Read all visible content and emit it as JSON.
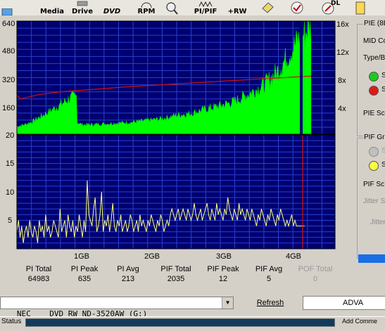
{
  "toolbar": {
    "buttons": [
      {
        "label": "Media",
        "icon": "cd-media-icon"
      },
      {
        "label": "Drive",
        "icon": "drive-icon"
      },
      {
        "label": "DVD",
        "icon": "dvd-logo-icon"
      },
      {
        "label": "RPM",
        "icon": "rpm-gauge-icon"
      },
      {
        "label": "",
        "icon": "magnifier-disc-icon"
      },
      {
        "label": "PI/PIF",
        "icon": "pi-pif-wave-icon"
      },
      {
        "label": "+RW",
        "icon": "plus-rw-icon"
      },
      {
        "label": "",
        "icon": "eraser-icon"
      },
      {
        "label": "",
        "icon": "disc-check-icon"
      },
      {
        "label": "DL",
        "icon": "dual-layer-disc-icon"
      },
      {
        "label": "",
        "icon": "document-icon"
      }
    ]
  },
  "chart_data": [
    {
      "type": "area",
      "subtype": "PI errors (bars) with read speed line",
      "y_left_ticks": [
        "640",
        "480",
        "320",
        "160",
        "20"
      ],
      "y_right_ticks": [
        "16x",
        "12x",
        "8x",
        "4x"
      ],
      "ylim_left": [
        0,
        640
      ],
      "ylim_right": [
        0,
        16
      ],
      "x_ticks": [
        "1GB",
        "2GB",
        "3GB",
        "4GB"
      ],
      "xlim_gb": [
        0,
        4.38
      ],
      "pi_envelope": {
        "x_gb": [
          0.0,
          0.1,
          0.2,
          0.3,
          0.4,
          0.5,
          0.6,
          0.7,
          0.8,
          0.82,
          0.9,
          1.0,
          1.2,
          1.4,
          1.6,
          1.8,
          2.0,
          2.2,
          2.4,
          2.6,
          2.8,
          3.0,
          3.2,
          3.4,
          3.6,
          3.8,
          3.9,
          4.0,
          4.05
        ],
        "values": [
          45,
          55,
          70,
          95,
          120,
          145,
          170,
          200,
          220,
          70,
          55,
          55,
          60,
          65,
          70,
          80,
          90,
          110,
          120,
          145,
          165,
          190,
          235,
          285,
          370,
          500,
          560,
          600,
          620
        ]
      },
      "speed_line": {
        "x_gb": [
          0.0,
          0.05,
          0.3,
          0.6,
          1.0,
          1.5,
          2.0,
          2.5,
          3.0,
          3.5,
          4.0,
          4.05
        ],
        "values": [
          5.5,
          5.0,
          5.6,
          6.0,
          6.3,
          6.7,
          7.0,
          7.3,
          7.6,
          7.9,
          8.2,
          8.2
        ]
      },
      "background": "#000070",
      "pi_color": "#00ff00",
      "speed_color": "#d01010"
    },
    {
      "type": "line",
      "subtype": "PIF errors",
      "y_left_ticks": [
        "20",
        "15",
        "10",
        "5"
      ],
      "ylim": [
        0,
        20
      ],
      "x_ticks": [
        "1GB",
        "2GB",
        "3GB",
        "4GB"
      ],
      "xlim_gb": [
        0,
        4.38
      ],
      "pif_values_per_0_02gb": [
        3,
        5,
        2,
        4,
        1,
        3,
        4,
        2,
        5,
        3,
        2,
        4,
        3,
        1,
        5,
        3,
        4,
        2,
        6,
        3,
        4,
        2,
        3,
        5,
        4,
        3,
        2,
        7,
        3,
        4,
        5,
        2,
        6,
        4,
        3,
        5,
        2,
        4,
        3,
        6,
        4,
        2,
        5,
        3,
        12,
        6,
        5,
        4,
        7,
        9,
        3,
        4,
        6,
        10,
        3,
        5,
        4,
        6,
        3,
        5,
        8,
        4,
        3,
        5,
        4,
        6,
        3,
        4,
        5,
        3,
        4,
        6,
        5,
        3,
        4,
        5,
        3,
        6,
        4,
        5,
        4,
        3,
        5,
        4,
        6,
        5,
        4,
        3,
        5,
        4,
        6,
        5,
        3,
        4,
        5,
        4,
        6,
        7,
        6,
        5,
        6,
        7,
        5,
        6,
        7,
        6,
        5,
        7,
        6,
        5,
        6,
        8,
        6,
        5,
        6,
        7,
        5,
        6,
        7,
        8,
        6,
        5,
        7,
        6,
        5,
        8,
        6,
        7,
        6,
        5,
        7,
        6,
        9,
        7,
        6,
        5,
        7,
        6,
        5,
        8,
        6,
        7,
        6,
        5,
        7,
        6,
        5,
        7,
        6,
        5,
        4,
        6,
        5,
        7,
        6,
        5,
        4,
        6,
        5,
        7,
        6,
        5,
        4,
        6,
        5,
        7,
        6,
        5,
        4,
        5,
        4,
        5,
        6,
        4,
        5,
        4,
        4,
        4,
        4,
        4,
        4
      ],
      "background": "#000070",
      "pif_color": "#ffff80",
      "marker_color": "#d01010"
    }
  ],
  "stats": [
    {
      "label": "PI Total",
      "value": "64983",
      "disabled": false
    },
    {
      "label": "PI Peak",
      "value": "635",
      "disabled": false
    },
    {
      "label": "PI Avg",
      "value": "213",
      "disabled": false
    },
    {
      "label": "PIF Total",
      "value": "2035",
      "disabled": false
    },
    {
      "label": "PIF Peak",
      "value": "12",
      "disabled": false
    },
    {
      "label": "PIF Avg",
      "value": "5",
      "disabled": false
    },
    {
      "label": "POF Total",
      "value": "0",
      "disabled": true
    }
  ],
  "right_panel": {
    "pie_group_title": "PIE (8E",
    "mid_label": "MID Co",
    "type_label": "Type/B",
    "pie_green_label": "S",
    "pie_red_label": "S",
    "pie_score_label": "PIE Sc",
    "pif_group_title": "PIF Gra",
    "pif_grey_label": "S",
    "pif_yellow_label": "S",
    "pif_score_label": "PIF Sc",
    "jitter1_label": "Jitter S",
    "jitter2_label": "Jitter",
    "dash": "--"
  },
  "bottom": {
    "drive": "_NEC    DVD_RW ND-3520AW (G:)",
    "refresh": "Refresh",
    "advanced": "ADVA"
  },
  "status": {
    "label": "Status",
    "right_text": "Add Comme"
  }
}
